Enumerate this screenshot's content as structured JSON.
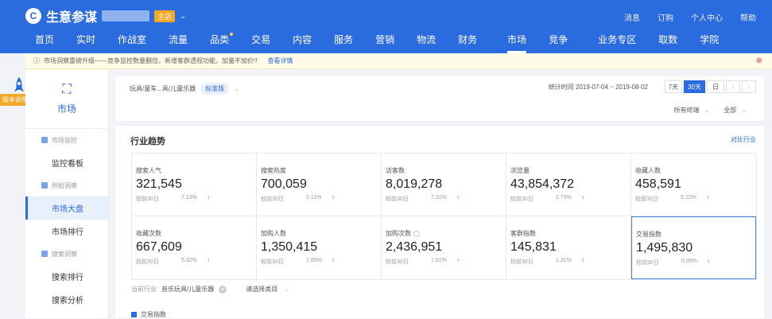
{
  "header": {
    "logo_mark": "C",
    "logo_text": "生意参谋",
    "shop_badge": "主店",
    "utility": [
      "消息",
      "订购",
      "个人中心",
      "帮助"
    ]
  },
  "nav": {
    "items": [
      "首页",
      "实时",
      "作战室",
      "流量",
      "品类",
      "交易",
      "内容",
      "服务",
      "营销",
      "物流",
      "财务",
      "市场",
      "竞争",
      "业务专区",
      "取数",
      "学院"
    ],
    "active": "市场"
  },
  "notice": {
    "text": "市场洞察重磅升级——竞争监控数量翻倍，新增客群透视功能，加量不加价!!",
    "link": "查看详情",
    "close": "⊗"
  },
  "float_label": "版本说明",
  "sidebar": {
    "head_icon": "⛶",
    "head_label": "市场",
    "group1": "市场监控",
    "g1_item1": "监控看板",
    "group2": "供给洞察",
    "g2_item1": "市场大盘",
    "g2_item2": "市场排行",
    "group3": "搜索洞察",
    "g3_item1": "搜索排行",
    "g3_item2": "搜索分析"
  },
  "filter": {
    "breadcrumb": "玩具/童车...具/儿童乐器",
    "tag": "标准版",
    "bc_chevron": "⌄",
    "date": "统计时间 2019-07-04 ~ 2019-08-02",
    "ranges": [
      "7天",
      "30天",
      "日"
    ],
    "prev": "‹",
    "next": "›",
    "select1": "所有终端",
    "select2": "全部",
    "select_chevron": "⌄"
  },
  "panel": {
    "title": "行业趋势",
    "link": "对比行业"
  },
  "metrics": [
    {
      "label": "搜索人气",
      "value": "321,545",
      "compare": "较前30日",
      "pct": "7.13%",
      "arrow": "↑"
    },
    {
      "label": "搜索热度",
      "value": "700,059",
      "compare": "较前30日",
      "pct": "0.11%",
      "arrow": "↑"
    },
    {
      "label": "访客数",
      "value": "8,019,278",
      "compare": "较前30日",
      "pct": "7.31%",
      "arrow": "↑"
    },
    {
      "label": "浏览量",
      "value": "43,854,372",
      "compare": "较前30日",
      "pct": "2.73%",
      "arrow": "↑"
    },
    {
      "label": "收藏人数",
      "value": "458,591",
      "compare": "较前30日",
      "pct": "5.22%",
      "arrow": "↑"
    },
    {
      "label": "收藏次数",
      "value": "667,609",
      "compare": "较前30日",
      "pct": "5.32%",
      "arrow": "↑"
    },
    {
      "label": "加购人数",
      "value": "1,350,415",
      "compare": "较前30日",
      "pct": "1.69%",
      "arrow": "↑"
    },
    {
      "label": "加购次数",
      "value": "2,436,951",
      "compare": "较前30日",
      "pct": "1.81%",
      "arrow": "↑"
    },
    {
      "label": "客群指数",
      "value": "145,831",
      "compare": "较前30日",
      "pct": "1.31%",
      "arrow": "↑"
    },
    {
      "label": "交易指数",
      "value": "1,495,830",
      "compare": "较前30日",
      "pct": "0.05%",
      "arrow": "↑"
    }
  ],
  "industry": {
    "label": "当前行业",
    "value": "音乐玩具/儿童乐器",
    "select": "请选择类目",
    "chevron": "⌄"
  },
  "legend": {
    "label": "交易指数"
  },
  "colors": {
    "primary": "#2a6be0",
    "up": "#e04848",
    "badge": "#f5a623"
  }
}
